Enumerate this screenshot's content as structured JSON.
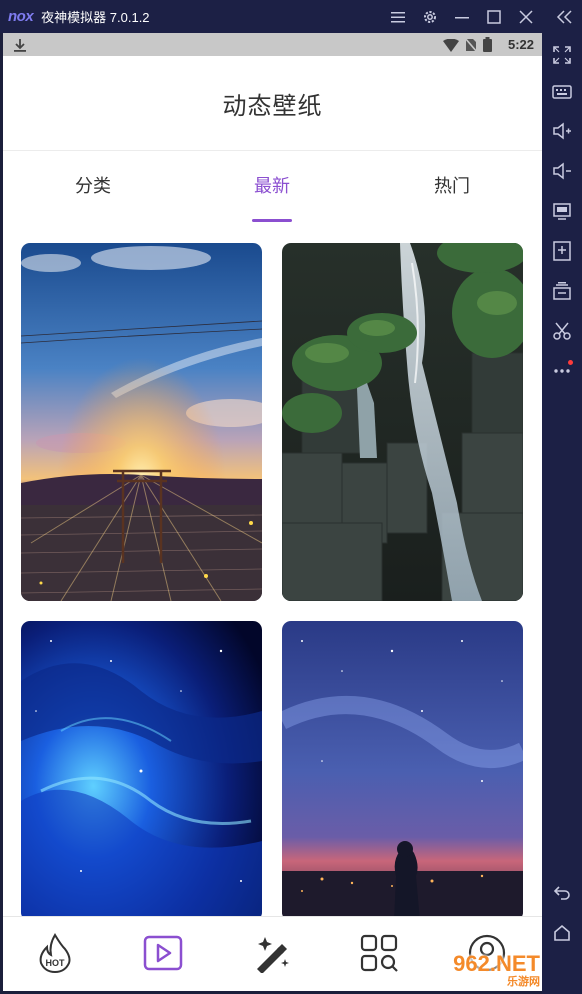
{
  "emulator": {
    "logo_text": "nox",
    "title": "夜神模拟器 7.0.1.2",
    "titlebar_buttons": [
      "menu-icon",
      "settings-gear-icon",
      "minimize-icon",
      "maximize-icon",
      "close-icon",
      "collapse-sidebar-icon"
    ],
    "sidebar_buttons": [
      "fullscreen-icon",
      "keyboard-icon",
      "volume-up-icon",
      "volume-down-icon",
      "screen-icon",
      "install-apk-icon",
      "multi-instance-icon",
      "scissors-icon",
      "more-icon"
    ],
    "sidebar_bottom_buttons": [
      "back-icon",
      "home-icon"
    ]
  },
  "statusbar": {
    "time": "5:22"
  },
  "app": {
    "title": "动态壁纸",
    "tabs": [
      {
        "label": "分类",
        "active": false
      },
      {
        "label": "最新",
        "active": true
      },
      {
        "label": "热门",
        "active": false
      }
    ],
    "accent_color": "#8b4fd0",
    "wallpapers": [
      {
        "name": "sunset-torii-wallpaper"
      },
      {
        "name": "waterfall-wallpaper"
      },
      {
        "name": "blue-nebula-wallpaper"
      },
      {
        "name": "starry-night-figure-wallpaper"
      }
    ],
    "bottom_nav": [
      {
        "name": "hot-icon",
        "label": "HOT",
        "active": false
      },
      {
        "name": "video-play-icon",
        "active": true
      },
      {
        "name": "magic-wand-icon",
        "active": false
      },
      {
        "name": "category-search-icon",
        "active": false
      },
      {
        "name": "profile-icon",
        "active": false
      }
    ]
  },
  "watermark": {
    "brand": "962.NET",
    "sub": "乐游网"
  }
}
